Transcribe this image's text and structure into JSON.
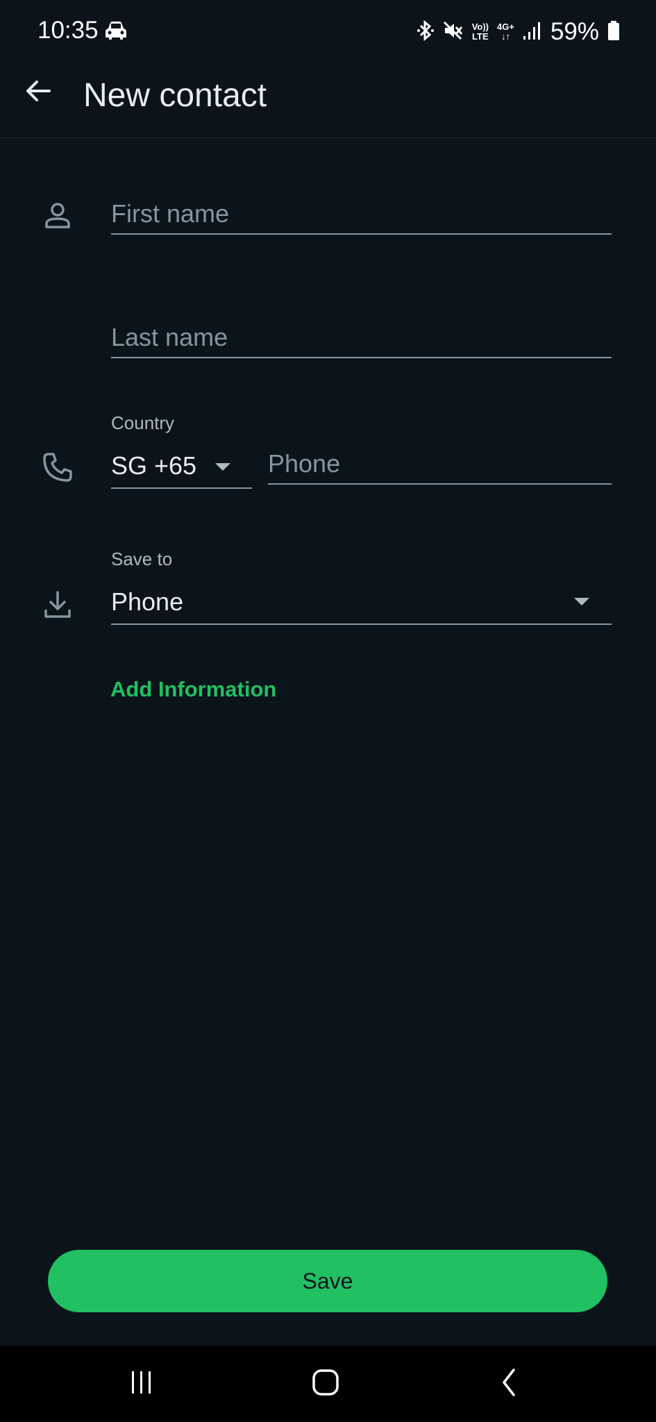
{
  "status_bar": {
    "time": "10:35",
    "volte_top": "Vo))",
    "volte_bottom": "LTE",
    "network_top": "4G+",
    "network_bottom": "↓↑",
    "battery_text": "59%",
    "icons": [
      "car-icon",
      "bluetooth-icon",
      "mute-icon",
      "signal-icon",
      "battery-icon"
    ]
  },
  "app_bar": {
    "title": "New contact",
    "back_icon": "arrow-left-icon"
  },
  "form": {
    "first_name": {
      "placeholder": "First name",
      "value": ""
    },
    "last_name": {
      "placeholder": "Last name",
      "value": ""
    },
    "country": {
      "label": "Country",
      "value": "SG +65"
    },
    "phone": {
      "placeholder": "Phone",
      "value": ""
    },
    "save_to": {
      "label": "Save to",
      "value": "Phone"
    },
    "add_information": "Add Information"
  },
  "save_button": "Save",
  "colors": {
    "background": "#0b141a",
    "accent": "#21c063",
    "text": "#e9edef",
    "muted": "#8696a0"
  },
  "nav_bar": {
    "icons": [
      "recents-icon",
      "home-icon",
      "back-icon"
    ]
  }
}
